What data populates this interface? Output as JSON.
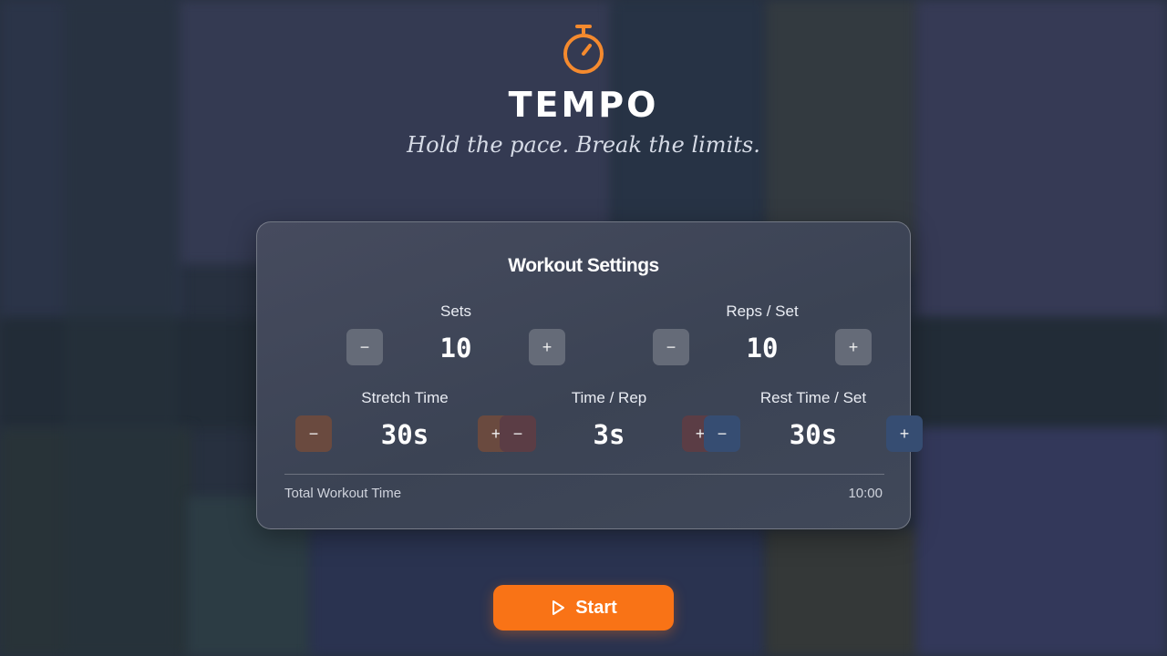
{
  "app": {
    "title": "TEMPO",
    "tagline": "Hold the pace. Break the limits."
  },
  "card": {
    "title": "Workout Settings",
    "settings": [
      {
        "label": "Sets",
        "value": "10",
        "minus": "−",
        "plus": "+"
      },
      {
        "label": "Reps / Set",
        "value": "10",
        "minus": "−",
        "plus": "+"
      },
      {
        "label": "Stretch Time",
        "value": "30s",
        "minus": "−",
        "plus": "+"
      },
      {
        "label": "Time / Rep",
        "value": "3s",
        "minus": "−",
        "plus": "+"
      },
      {
        "label": "Rest Time / Set",
        "value": "30s",
        "minus": "−",
        "plus": "+"
      }
    ],
    "total_label": "Total Workout Time",
    "total_value": "10:00"
  },
  "start_button": {
    "label": "Start",
    "icon": "play-icon"
  },
  "colors": {
    "accent": "#f97316",
    "stepper_gray": "#656b78",
    "stepper_brown": "#6a4a3f",
    "stepper_maroon": "#5b3d45",
    "stepper_blue": "#364d72"
  },
  "icons": {
    "logo": "stopwatch-icon"
  }
}
